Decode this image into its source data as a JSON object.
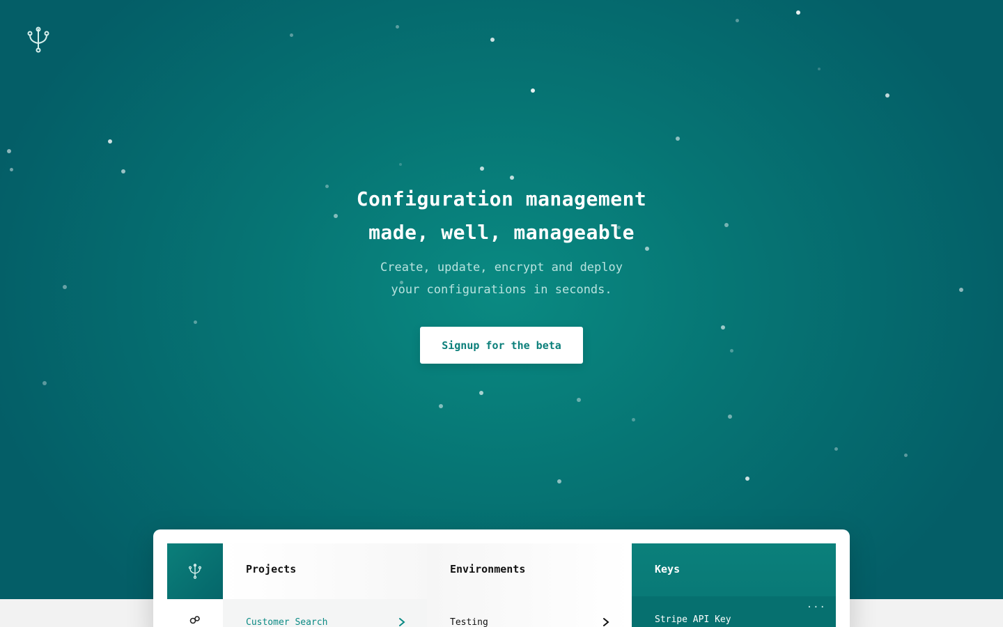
{
  "hero": {
    "headline_line1": "Configuration management",
    "headline_line2": "made, well, manageable",
    "subhead_line1": "Create, update, encrypt and deploy",
    "subhead_line2": "your configurations in seconds.",
    "cta_label": "Signup for the beta"
  },
  "app_preview": {
    "projects": {
      "title": "Projects",
      "item": "Customer Search"
    },
    "environments": {
      "title": "Environments",
      "item": "Testing"
    },
    "keys": {
      "title": "Keys",
      "item": "Stripe API Key",
      "more": "···"
    }
  },
  "icons": {
    "logo": "fork-logo-icon",
    "sidebar_logo": "fork-logo-icon",
    "sidebar_nav": "infinity-icon",
    "chevron": "chevron-right-icon",
    "more": "more-dots-icon"
  },
  "colors": {
    "brand": "#0b7f7a",
    "hero_bg_dark": "#045e67",
    "hero_bg_light": "#0a8a82",
    "cta_bg": "#ffffff"
  }
}
